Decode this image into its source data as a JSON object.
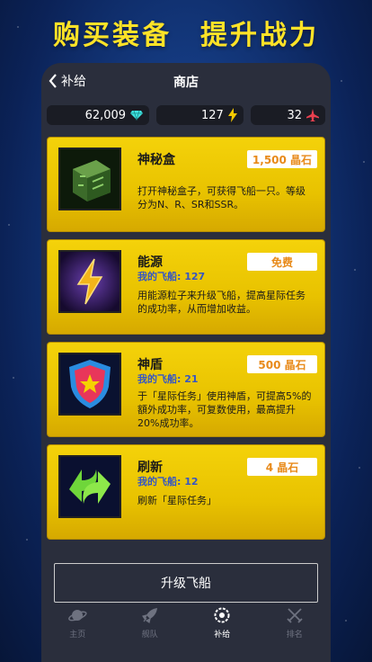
{
  "headline": {
    "part1": "购买装备",
    "part2": "提升战力"
  },
  "nav": {
    "back_label": "补给",
    "title": "商店"
  },
  "stats": [
    {
      "value": "62,009",
      "icon": "diamond-icon"
    },
    {
      "value": "127",
      "icon": "lightning-icon"
    },
    {
      "value": "32",
      "icon": "jet-icon"
    }
  ],
  "items": [
    {
      "title": "神秘盒",
      "sub": "",
      "price": "1,500 晶石",
      "desc": "打开神秘盒子，可获得飞船一只。等级分为N、R、SR和SSR。"
    },
    {
      "title": "能源",
      "sub": "我的飞船: 127",
      "price": "免费",
      "desc": "用能源粒子来升级飞船，提高星际任务的成功率，从而增加收益。"
    },
    {
      "title": "神盾",
      "sub": "我的飞船: 21",
      "price": "500 晶石",
      "desc": "于「星际任务」使用神盾，可提高5%的額外成功率，可复数使用，最高提升20%成功率。"
    },
    {
      "title": "刷新",
      "sub": "我的飞船: 12",
      "price": "4 晶石",
      "desc": "刷新「星际任务」"
    }
  ],
  "upgrade_label": "升级飞船",
  "tabs": [
    {
      "label": "主页",
      "icon": "planet-icon"
    },
    {
      "label": "舰队",
      "icon": "rocket-icon"
    },
    {
      "label": "补给",
      "icon": "gear-icon"
    },
    {
      "label": "排名",
      "icon": "swords-icon"
    }
  ],
  "colors": {
    "accent_yellow": "#ffe327",
    "card_gold": "#f4d20a",
    "sub_blue": "#3556c4",
    "price_orange": "#e88a1a"
  }
}
